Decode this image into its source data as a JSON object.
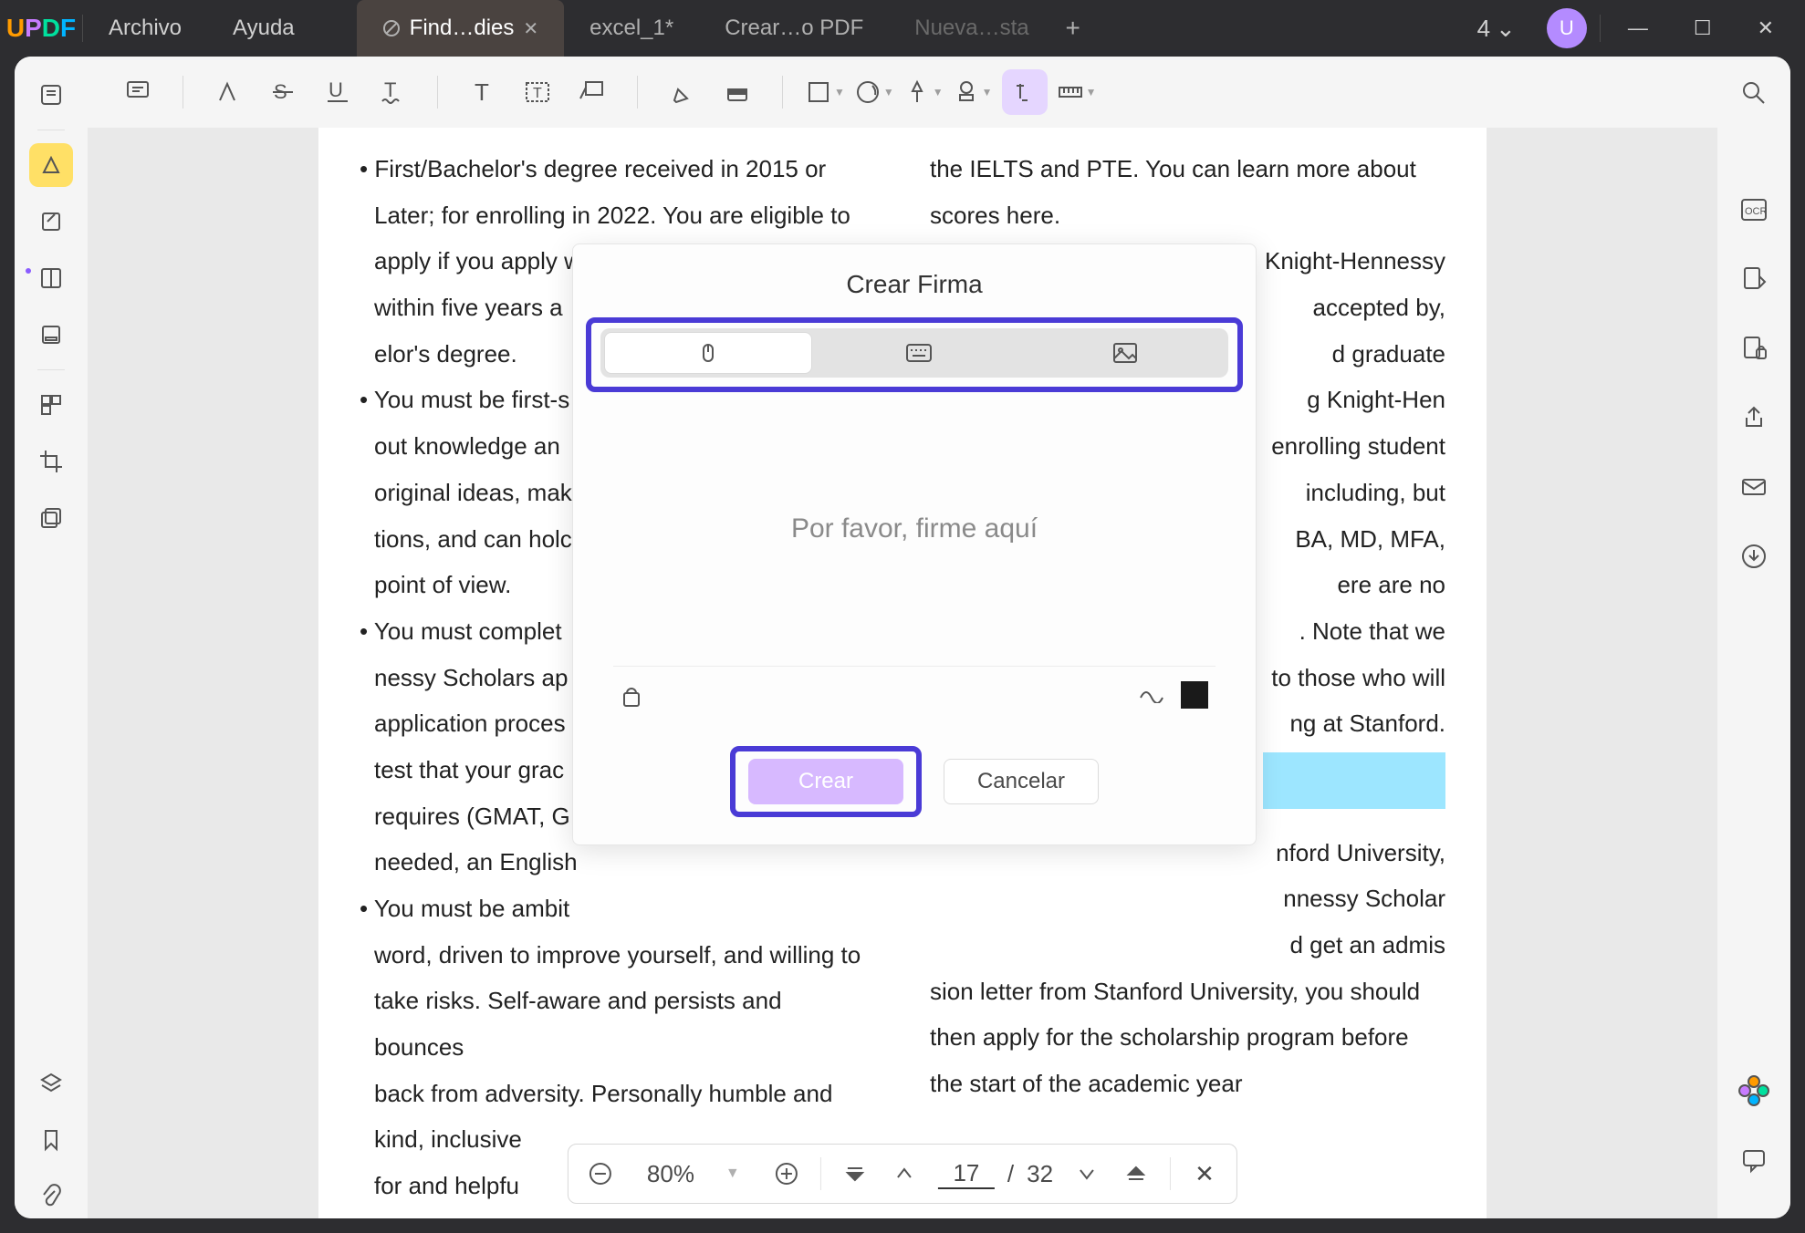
{
  "titlebar": {
    "menu": {
      "file": "Archivo",
      "help": "Ayuda"
    },
    "tabs": [
      {
        "label": "Find…dies",
        "active": true,
        "closable": true
      },
      {
        "label": "excel_1*"
      },
      {
        "label": "Crear…o PDF"
      },
      {
        "label": "Nueva…sta",
        "dim": true
      }
    ],
    "tab_count": "4",
    "avatar_letter": "U"
  },
  "modal": {
    "title": "Crear Firma",
    "canvas_placeholder": "Por favor, firme aquí",
    "create_label": "Crear",
    "cancel_label": "Cancelar",
    "modes": {
      "mouse": "mouse",
      "keyboard": "keyboard",
      "image": "image"
    },
    "swatch_color": "#1a1a1a"
  },
  "bottombar": {
    "zoom_value": "80%",
    "page_current": "17",
    "page_total": "32"
  },
  "document": {
    "left_col": [
      "• First/Bachelor's degree received in 2015 or",
      "Later; for enrolling in 2022. You are eligible to",
      "apply if you apply w",
      "within five years a",
      "elor's degree.",
      "• You must be first-s",
      "out knowledge an",
      "original ideas, mak",
      "tions, and can holc",
      "point of view.",
      "• You must complet",
      "nessy Scholars ap",
      "application proces",
      "test that your grac",
      "requires (GMAT, G",
      "needed, an English",
      "• You must be ambit",
      "word, driven to improve yourself, and willing to",
      "take risks. Self-aware and persists and bounces",
      "back from adversity. Personally humble and",
      "kind, inclusive",
      "for and helpfu"
    ],
    "right_col": [
      "the IELTS and PTE. You can learn more about",
      "scores here.",
      "Knight-Hennessy",
      "accepted by,",
      "d graduate",
      "g Knight-Hen",
      "enrolling student",
      "including, but",
      "BA, MD, MFA,",
      "ere are no",
      ". Note that we",
      "to those who will",
      "ng at Stanford.",
      "",
      "nford University,",
      "nnessy Scholar",
      "d get an admis",
      "sion letter from Stanford University, you should",
      "then apply for the scholarship program before",
      "the start of the academic year"
    ]
  },
  "colors": {
    "accent": "#4a3bd6",
    "highlight": "#ffe066",
    "pill_active": "#e5d6ff",
    "modal_btn": "#d7b9ff"
  }
}
